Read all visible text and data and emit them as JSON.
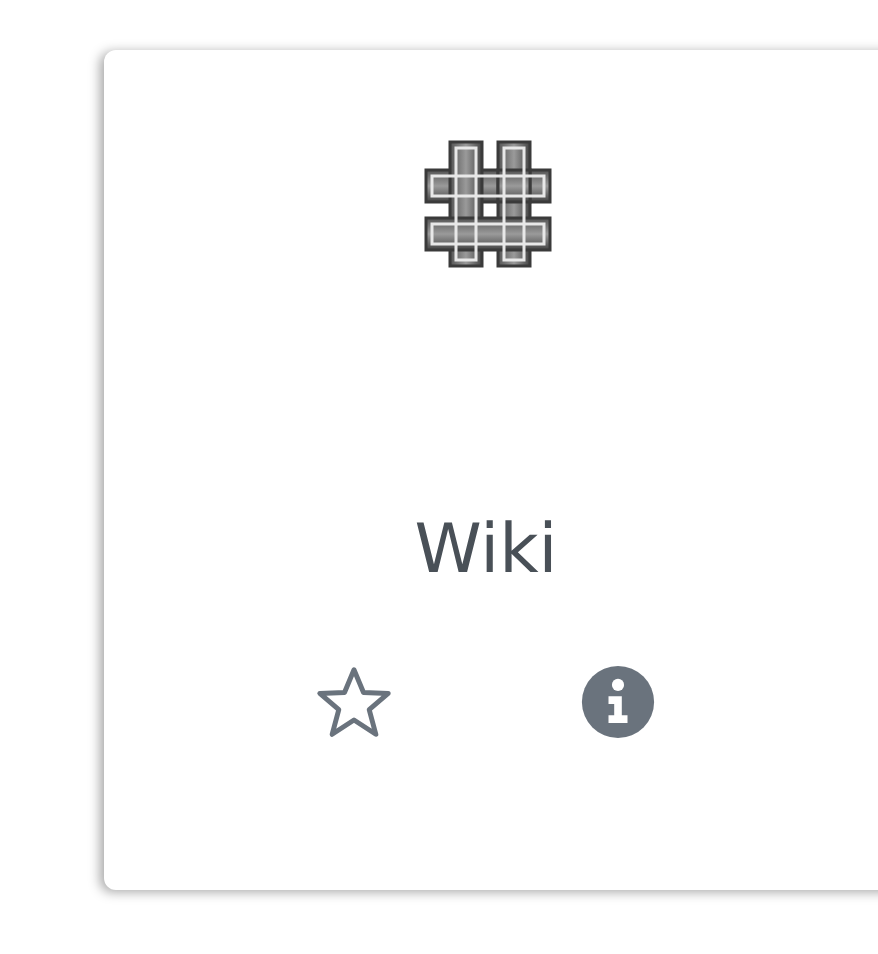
{
  "card": {
    "title": "Wiki",
    "starred": false
  }
}
